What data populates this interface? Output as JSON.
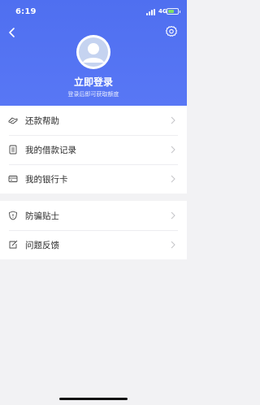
{
  "status": {
    "time": "6:19",
    "network": "4G"
  },
  "profile": {
    "login_title": "立即登录",
    "login_subtitle": "登录后即可获取额度"
  },
  "menu_primary": [
    {
      "label": "还款帮助",
      "icon": "repay-help-icon"
    },
    {
      "label": "我的借款记录",
      "icon": "loan-record-icon"
    },
    {
      "label": "我的银行卡",
      "icon": "bank-card-icon"
    }
  ],
  "menu_secondary": [
    {
      "label": "防骗贴士",
      "icon": "shield-icon"
    },
    {
      "label": "问题反馈",
      "icon": "feedback-icon"
    }
  ],
  "colors": {
    "header": "#5270f2",
    "background": "#f2f2f4"
  }
}
